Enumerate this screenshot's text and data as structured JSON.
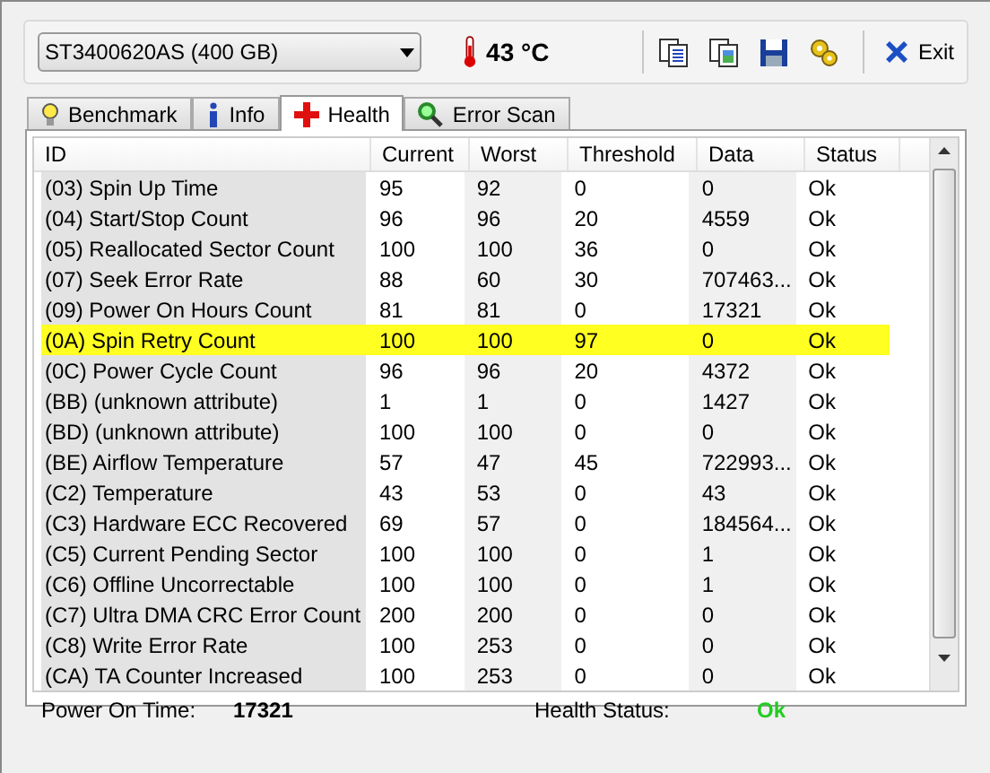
{
  "toolbar": {
    "drive": "ST3400620AS (400 GB)",
    "temperature": "43 °C",
    "exit_label": "Exit"
  },
  "tabs": [
    {
      "label": "Benchmark",
      "selected": false
    },
    {
      "label": "Info",
      "selected": false
    },
    {
      "label": "Health",
      "selected": true
    },
    {
      "label": "Error Scan",
      "selected": false
    }
  ],
  "table": {
    "columns": [
      "ID",
      "Current",
      "Worst",
      "Threshold",
      "Data",
      "Status"
    ],
    "rows": [
      {
        "cells": [
          "(03) Spin Up Time",
          "95",
          "92",
          "0",
          "0",
          "Ok"
        ],
        "selected": false
      },
      {
        "cells": [
          "(04) Start/Stop Count",
          "96",
          "96",
          "20",
          "4559",
          "Ok"
        ],
        "selected": false
      },
      {
        "cells": [
          "(05) Reallocated Sector Count",
          "100",
          "100",
          "36",
          "0",
          "Ok"
        ],
        "selected": false
      },
      {
        "cells": [
          "(07) Seek Error Rate",
          "88",
          "60",
          "30",
          "707463...",
          "Ok"
        ],
        "selected": false
      },
      {
        "cells": [
          "(09) Power On Hours Count",
          "81",
          "81",
          "0",
          "17321",
          "Ok"
        ],
        "selected": false
      },
      {
        "cells": [
          "(0A) Spin Retry Count",
          "100",
          "100",
          "97",
          "0",
          "Ok"
        ],
        "selected": true
      },
      {
        "cells": [
          "(0C) Power Cycle Count",
          "96",
          "96",
          "20",
          "4372",
          "Ok"
        ],
        "selected": false
      },
      {
        "cells": [
          "(BB) (unknown attribute)",
          "1",
          "1",
          "0",
          "1427",
          "Ok"
        ],
        "selected": false
      },
      {
        "cells": [
          "(BD) (unknown attribute)",
          "100",
          "100",
          "0",
          "0",
          "Ok"
        ],
        "selected": false
      },
      {
        "cells": [
          "(BE) Airflow Temperature",
          "57",
          "47",
          "45",
          "722993...",
          "Ok"
        ],
        "selected": false
      },
      {
        "cells": [
          "(C2) Temperature",
          "43",
          "53",
          "0",
          "43",
          "Ok"
        ],
        "selected": false
      },
      {
        "cells": [
          "(C3) Hardware ECC Recovered",
          "69",
          "57",
          "0",
          "184564...",
          "Ok"
        ],
        "selected": false
      },
      {
        "cells": [
          "(C5) Current Pending Sector",
          "100",
          "100",
          "0",
          "1",
          "Ok"
        ],
        "selected": false
      },
      {
        "cells": [
          "(C6) Offline Uncorrectable",
          "100",
          "100",
          "0",
          "1",
          "Ok"
        ],
        "selected": false
      },
      {
        "cells": [
          "(C7) Ultra DMA CRC Error Count",
          "200",
          "200",
          "0",
          "0",
          "Ok"
        ],
        "selected": false
      },
      {
        "cells": [
          "(C8) Write Error Rate",
          "100",
          "253",
          "0",
          "0",
          "Ok"
        ],
        "selected": false
      },
      {
        "cells": [
          "(CA) TA Counter Increased",
          "100",
          "253",
          "0",
          "0",
          "Ok"
        ],
        "selected": false
      }
    ]
  },
  "footer": {
    "power_on_label": "Power On Time:",
    "power_on_value": "17321",
    "health_label": "Health Status:",
    "health_value": "Ok"
  }
}
